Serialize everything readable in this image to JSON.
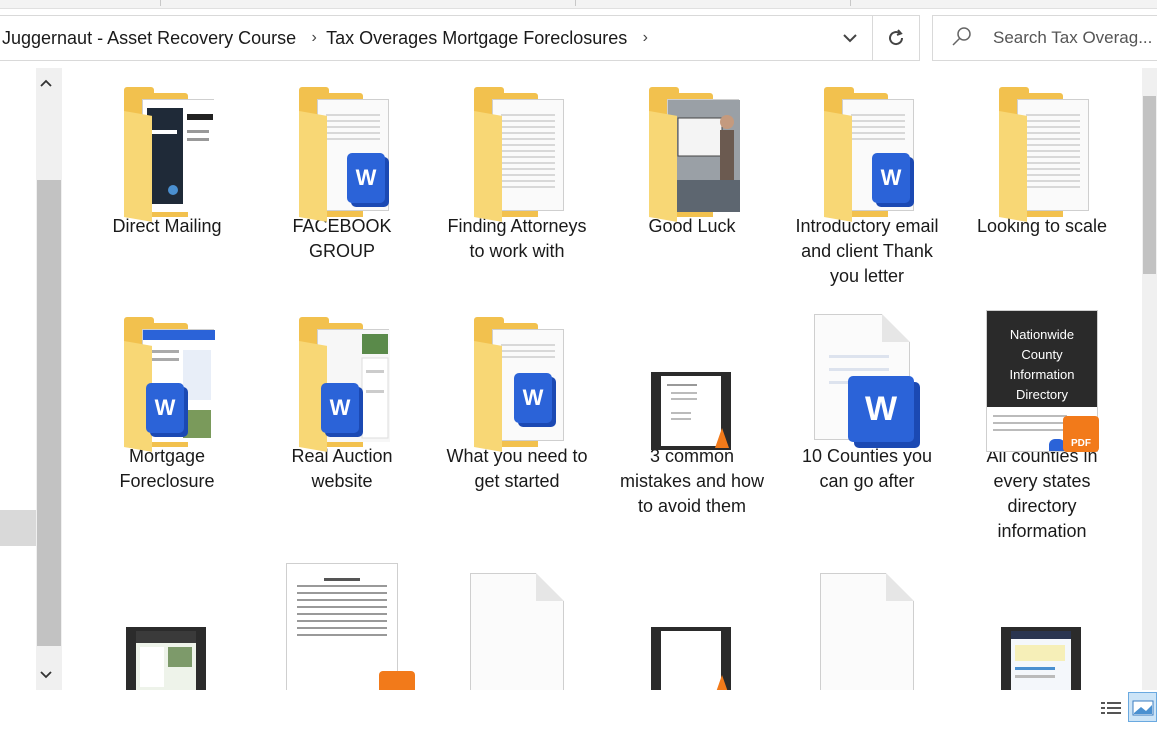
{
  "breadcrumb": {
    "items": [
      "Juggernaut - Asset Recovery Course",
      "Tax Overages Mortgage Foreclosures"
    ]
  },
  "search": {
    "placeholder": "Search Tax Overag..."
  },
  "icons": {
    "dropdown": "chevron-down-icon",
    "refresh": "refresh-icon",
    "search": "search-icon"
  },
  "files": [
    {
      "label": "Direct Mailing",
      "kind": "folder-doc"
    },
    {
      "label": "FACEBOOK GROUP",
      "kind": "folder-word"
    },
    {
      "label": "Finding Attorneys to work with",
      "kind": "folder-doc"
    },
    {
      "label": "Good Luck",
      "kind": "folder-photo"
    },
    {
      "label": "Introductory email and client Thank you letter",
      "kind": "folder-word"
    },
    {
      "label": "Looking to scale",
      "kind": "folder-doc"
    },
    {
      "label": "Mortgage Foreclosure",
      "kind": "folder-word"
    },
    {
      "label": "Real Auction website",
      "kind": "folder-word"
    },
    {
      "label": "What you need to get started",
      "kind": "folder-word"
    },
    {
      "label": "3 common mistakes and how to avoid them",
      "kind": "video"
    },
    {
      "label": "10 Counties you can go after",
      "kind": "word"
    },
    {
      "label": "All counties in every states directory information",
      "kind": "pdf"
    }
  ],
  "thumb_text": {
    "directory_title": "Nationwide County Information Directory",
    "word_letter": "W",
    "pdf_text": "PDF"
  },
  "colors": {
    "folder": "#f2c14e",
    "word": "#2b63d8",
    "pdf": "#f27a1a",
    "selected_view": "#cce4f7"
  }
}
